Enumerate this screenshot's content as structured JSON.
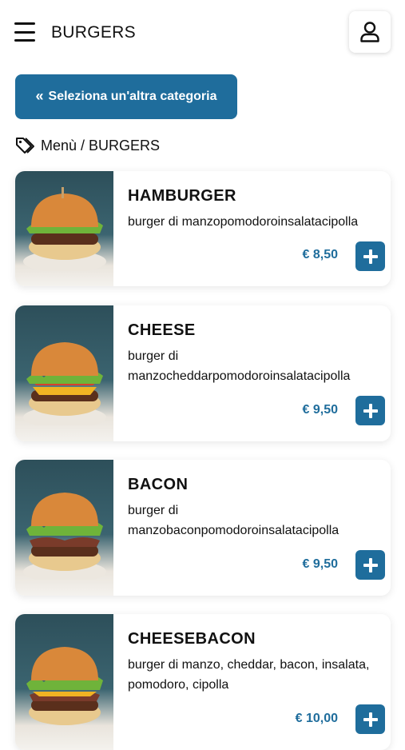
{
  "header": {
    "title": "BURGERS",
    "menu_icon": "hamburger-menu-icon",
    "user_icon": "user-icon"
  },
  "category_button": {
    "label": "Seleziona un'altra categoria",
    "icon": "double-chevron-left-icon"
  },
  "breadcrumb": {
    "icon": "tags-icon",
    "text": "Menù / BURGERS"
  },
  "products": [
    {
      "name": "HAMBURGER",
      "description": "burger di manzopomodoroinsalatacipolla",
      "price": "€ 8,50"
    },
    {
      "name": "CHEESE",
      "description": "burger di manzocheddarpomodoroinsalatacipolla",
      "price": "€ 9,50"
    },
    {
      "name": "BACON",
      "description": "burger di manzobaconpomodoroinsalatacipolla",
      "price": "€ 9,50"
    },
    {
      "name": "CHEESEBACON",
      "description": "burger di manzo, cheddar, bacon, insalata, pomodoro, cipolla",
      "price": "€ 10,00"
    }
  ],
  "colors": {
    "accent": "#1f6d9c",
    "text": "#111111",
    "background": "#ffffff"
  }
}
